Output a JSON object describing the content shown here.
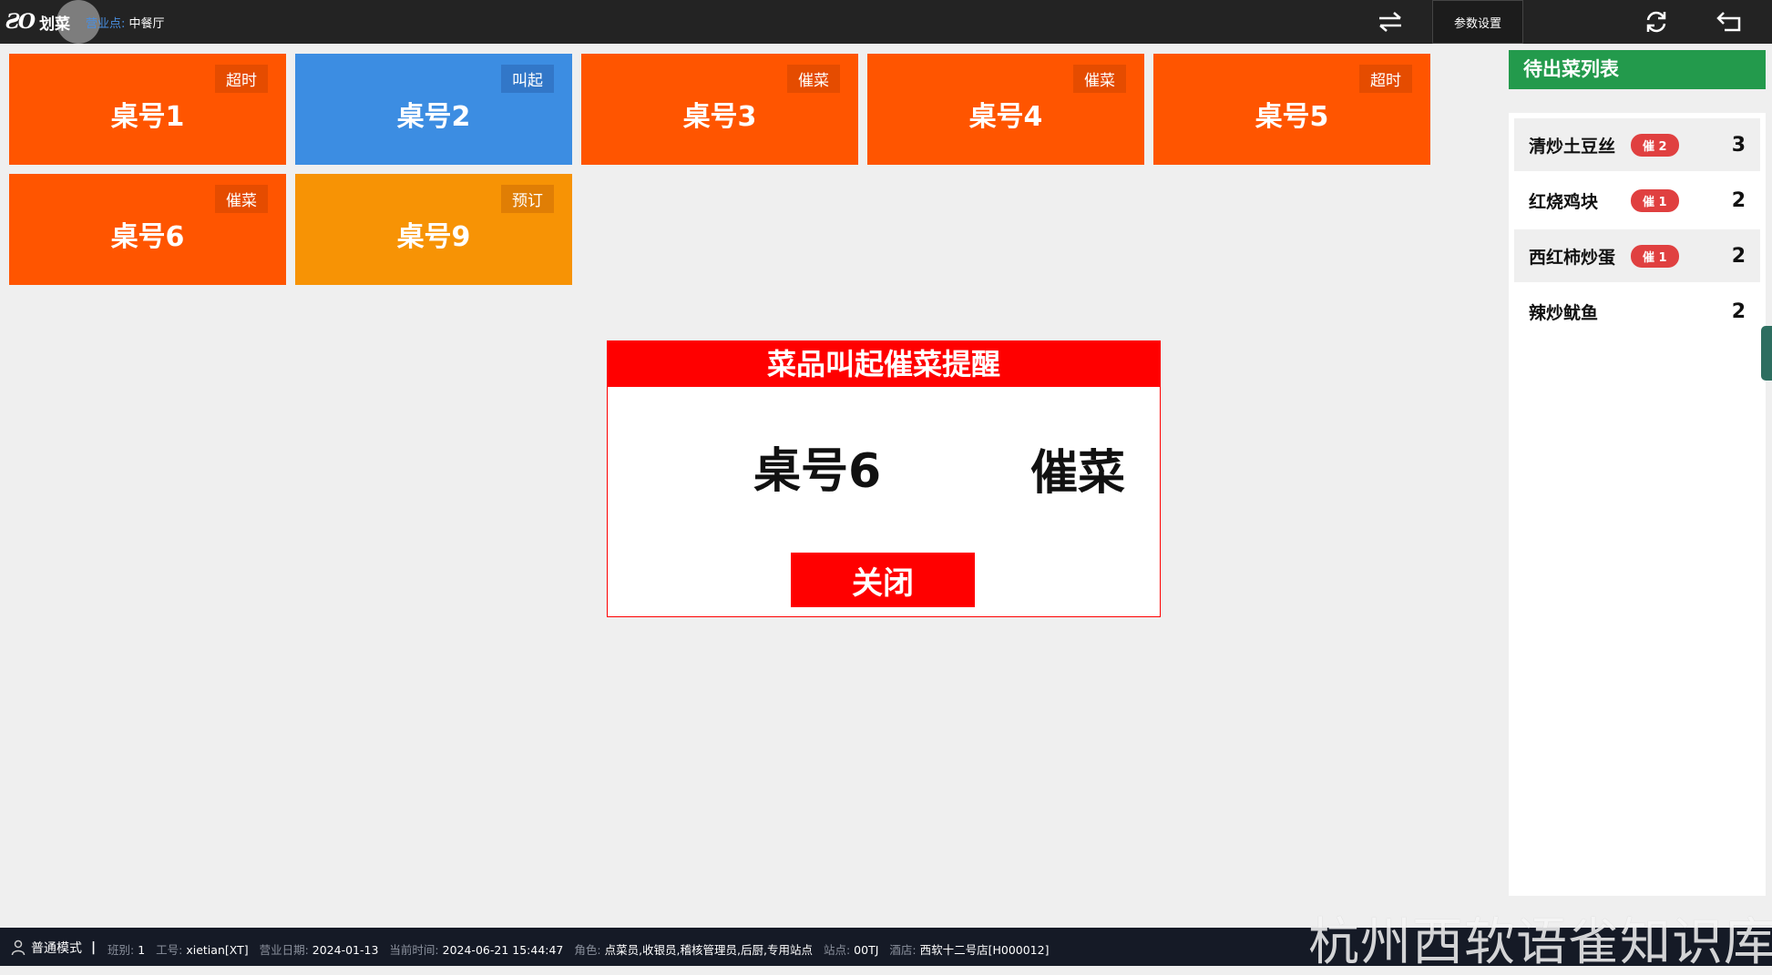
{
  "app": {
    "logo_mark": "ƧO",
    "title": "划菜",
    "biz_label": "营业点:",
    "biz_value": "中餐厅"
  },
  "toolbar": {
    "settings_label": "参数设置",
    "icons": [
      "swap-icon",
      "refresh-icon",
      "back-icon"
    ]
  },
  "tables": [
    {
      "name": "桌号1",
      "badge": "超时",
      "color": "#ff5500"
    },
    {
      "name": "桌号2",
      "badge": "叫起",
      "color": "#3c8de2"
    },
    {
      "name": "桌号3",
      "badge": "催菜",
      "color": "#ff5500"
    },
    {
      "name": "桌号4",
      "badge": "催菜",
      "color": "#ff5500"
    },
    {
      "name": "桌号5",
      "badge": "超时",
      "color": "#ff5500"
    },
    {
      "name": "桌号6",
      "badge": "催菜",
      "color": "#ff5500"
    },
    {
      "name": "桌号9",
      "badge": "预订",
      "color": "#f79305"
    }
  ],
  "pending": {
    "title": "待出菜列表",
    "items": [
      {
        "name": "清炒土豆丝",
        "badge": "催 2",
        "count": "3"
      },
      {
        "name": "红烧鸡块",
        "badge": "催 1",
        "count": "2"
      },
      {
        "name": "西红柿炒蛋",
        "badge": "催 1",
        "count": "2"
      },
      {
        "name": "辣炒鱿鱼",
        "badge": "",
        "count": "2"
      }
    ]
  },
  "dialog": {
    "title": "菜品叫起催菜提醒",
    "table": "桌号6",
    "action": "催菜",
    "close_label": "关闭"
  },
  "status": {
    "mode": "普通模式",
    "separator": "|",
    "fields": [
      {
        "label": "班别:",
        "value": "1"
      },
      {
        "label": "工号:",
        "value": "xietian[XT]"
      },
      {
        "label": "营业日期:",
        "value": "2024-01-13"
      },
      {
        "label": "当前时间:",
        "value": "2024-06-21 15:44:47"
      },
      {
        "label": "角色:",
        "value": "点菜员,收银员,稽核管理员,后厨,专用站点"
      },
      {
        "label": "站点:",
        "value": "00TJ"
      },
      {
        "label": "酒店:",
        "value": "西软十二号店[H000012]"
      }
    ]
  },
  "watermark": "杭州西软语雀知识库"
}
